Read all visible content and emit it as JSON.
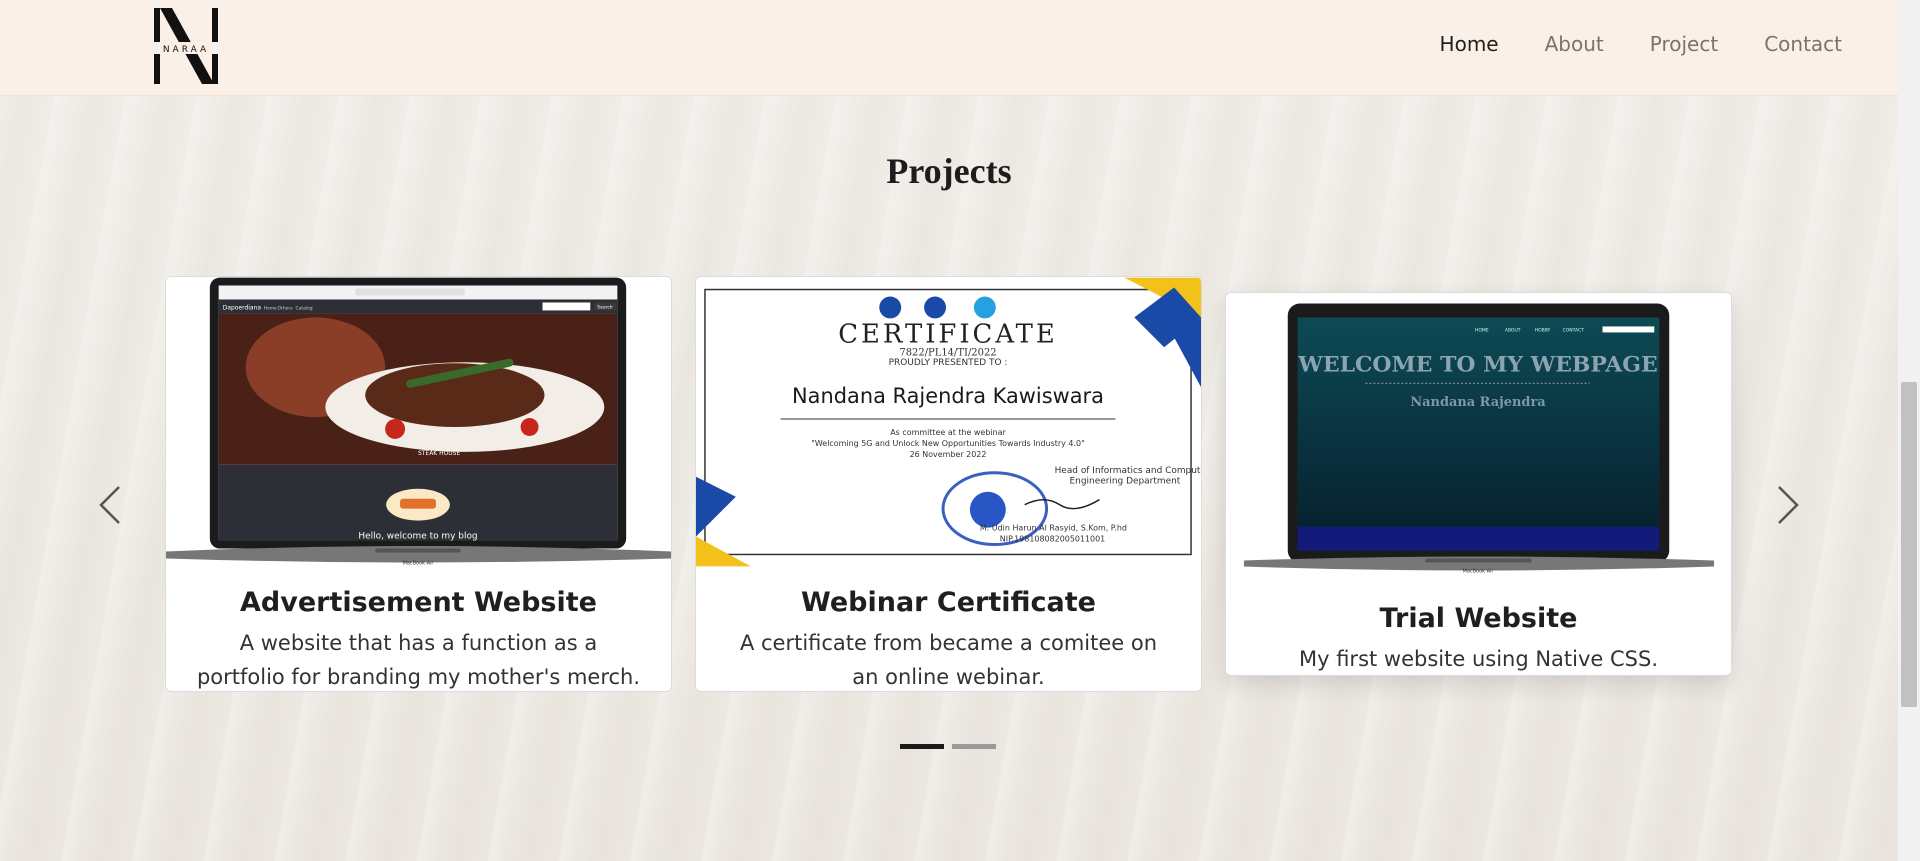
{
  "logo": {
    "letters": "NARAA"
  },
  "nav": {
    "links": [
      {
        "label": "Home"
      },
      {
        "label": "About"
      },
      {
        "label": "Project"
      },
      {
        "label": "Contact"
      }
    ]
  },
  "section": {
    "title": "Projects"
  },
  "cards": [
    {
      "title": "Advertisement Website",
      "text": "A website that has a function as a portfolio for branding my mother's merch.",
      "screen": {
        "brand": "Dapoerdiana",
        "menu": [
          "Home",
          "Others",
          "Catalog"
        ],
        "search": "Search",
        "slide_caption": "STEAK HOUSE",
        "welcome": "Hello, welcome to my blog",
        "laptop_label": "MacBook Air"
      }
    },
    {
      "title": "Webinar Certificate",
      "text": "A certificate from became a comitee on an online webinar.",
      "certificate": {
        "heading": "CERTIFICATE",
        "number": "7822/PL14/TI/2022",
        "presented": "PROUDLY PRESENTED TO :",
        "name": "Nandana Rajendra Kawiswara",
        "line1": "As committee at the webinar",
        "line2": "\"Welcoming 5G and Unlock New Opportunities Towards Industry 4.0\"",
        "date": "26 November 2022",
        "role1": "Head of Informatics and Computer",
        "role2": "Engineering Department",
        "signer": "M. Udin Harun Al Rasyid, S.Kom, P.hd",
        "nip": "NIP.198108082005011001"
      }
    },
    {
      "title": "Trial Website",
      "text": "My first website using Native CSS.",
      "screen": {
        "menu": [
          "HOME",
          "ABOUT",
          "HOBBY",
          "CONTACT"
        ],
        "headline": "WELCOME TO MY WEBPAGE",
        "subtitle": "Nandana Rajendra",
        "laptop_label": "MacBook Air"
      }
    }
  ],
  "colors": {
    "nav_bg": "#fbf0e7",
    "page_bg": "#efebe6",
    "text_dark": "#1f1f1f",
    "nav_muted": "#7a736d",
    "cert_blue": "#1a4aa8",
    "cert_yellow": "#f2c21b"
  }
}
